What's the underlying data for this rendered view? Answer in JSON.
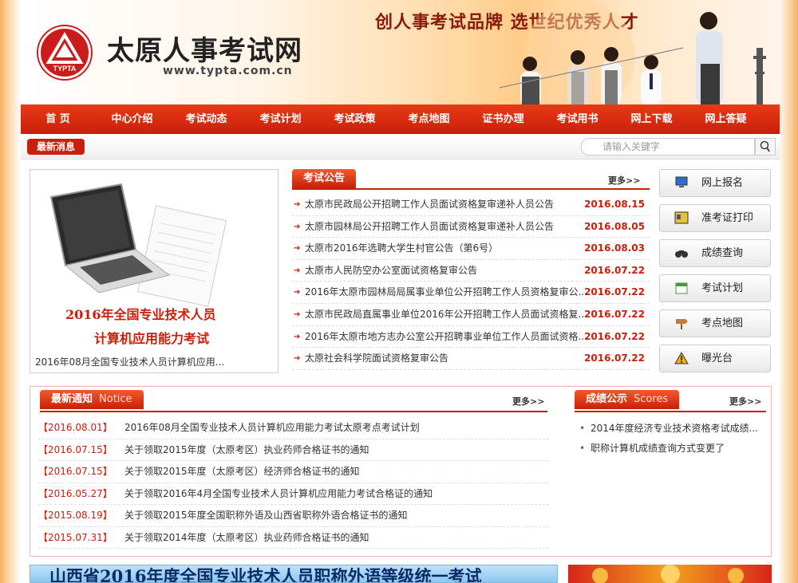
{
  "header": {
    "site_title": "太原人事考试网",
    "site_url": "www.typta.com.cn",
    "logo_text": "TYPTA",
    "slogan": "创人事考试品牌  选世纪优秀人才"
  },
  "nav": {
    "items": [
      "首 页",
      "中心介绍",
      "考试动态",
      "考试计划",
      "考试政策",
      "考点地图",
      "证书办理",
      "考试用书",
      "网上下载",
      "网上答疑"
    ]
  },
  "newsbar": {
    "label": "最新消息",
    "search_placeholder": "请输入关键字"
  },
  "featured": {
    "title_line1": "2016年全国专业技术人员",
    "title_line2": "计算机应用能力考试",
    "caption": "2016年08月全国专业技术人员计算机应用..."
  },
  "announcements": {
    "title": "考试公告",
    "more": "更多>>",
    "items": [
      {
        "title": "太原市民政局公开招聘工作人员面试资格复审递补人员公告",
        "date": "2016.08.15"
      },
      {
        "title": "太原市园林局公开招聘工作人员面试资格复审递补人员公告",
        "date": "2016.08.05"
      },
      {
        "title": "太原市2016年选聘大学生村官公告（第6号）",
        "date": "2016.08.03"
      },
      {
        "title": "太原市人民防空办公室面试资格复审公告",
        "date": "2016.07.22"
      },
      {
        "title": "2016年太原市园林局局属事业单位公开招聘工作人员资格复审公...",
        "date": "2016.07.22"
      },
      {
        "title": "太原市民政局直属事业单位2016年公开招聘工作人员面试资格复...",
        "date": "2016.07.22"
      },
      {
        "title": "2016年太原市地方志办公室公开招聘事业单位工作人员面试资格...",
        "date": "2016.07.22"
      },
      {
        "title": "太原社会科学院面试资格复审公告",
        "date": "2016.07.22"
      }
    ]
  },
  "quick_links": [
    {
      "label": "网上报名",
      "icon": "computer-icon"
    },
    {
      "label": "准考证打印",
      "icon": "id-card-icon"
    },
    {
      "label": "成绩查询",
      "icon": "binoculars-icon"
    },
    {
      "label": "考试计划",
      "icon": "calendar-icon"
    },
    {
      "label": "考点地图",
      "icon": "signpost-icon"
    },
    {
      "label": "曝光台",
      "icon": "warning-icon"
    }
  ],
  "latest_notice": {
    "title": "最新通知",
    "title_en": "Notice",
    "more": "更多>>",
    "items": [
      {
        "date": "【2016.08.01】",
        "title": "2016年08月全国专业技术人员计算机应用能力考试太原考点考试计划"
      },
      {
        "date": "【2016.07.15】",
        "title": "关于领取2015年度（太原考区）执业药师合格证书的通知"
      },
      {
        "date": "【2016.07.15】",
        "title": "关于领取2015年度（太原考区）经济师合格证书的通知"
      },
      {
        "date": "【2016.05.27】",
        "title": "关于领取2016年4月全国专业技术人员计算机应用能力考试合格证的通知"
      },
      {
        "date": "【2015.08.19】",
        "title": "关于领取2015年度全国职称外语及山西省职称外语合格证书的通知"
      },
      {
        "date": "【2015.07.31】",
        "title": "关于领取2014年度（太原考区）执业药师合格证书的通知"
      }
    ]
  },
  "scores": {
    "title": "成绩公示",
    "title_en": "Scores",
    "more": "更多>>",
    "items": [
      "2014年度经济专业技术资格考试成绩...",
      "职称计算机成绩查询方式变更了"
    ]
  },
  "banner": {
    "text": "山西省2016年度全国专业技术人员职称外语等级统一考试"
  }
}
